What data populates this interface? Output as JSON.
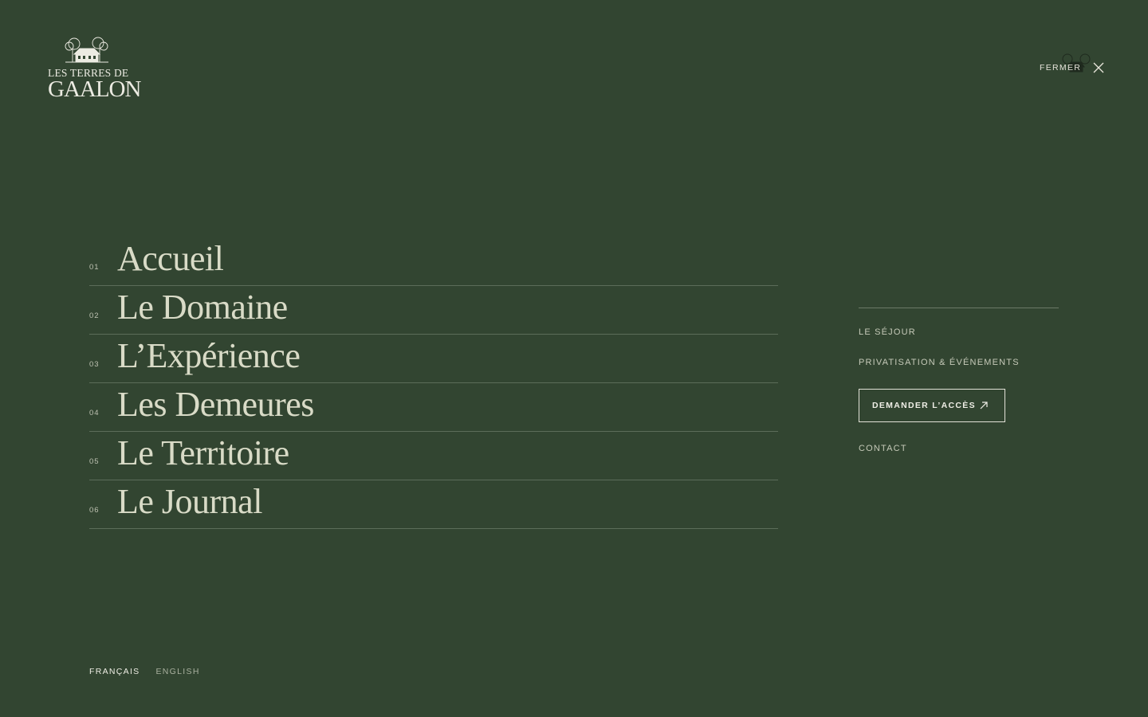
{
  "brand": {
    "line1": "LES TERRES DE",
    "line2": "GAALON"
  },
  "header": {
    "close_label": "FERMER",
    "close_icon": "close-icon"
  },
  "nav": {
    "items": [
      {
        "num": "01",
        "label": "Accueil"
      },
      {
        "num": "02",
        "label": "Le Domaine"
      },
      {
        "num": "03",
        "label": "L’Expérience"
      },
      {
        "num": "04",
        "label": "Les Demeures"
      },
      {
        "num": "05",
        "label": "Le Territoire"
      },
      {
        "num": "06",
        "label": "Le Journal"
      }
    ]
  },
  "side": {
    "sejour": "LE SÉJOUR",
    "privatisation": "PRIVATISATION & ÉVÉNEMENTS",
    "cta_label": "DEMANDER L’ACCÈS",
    "cta_icon": "arrow-up-right-icon",
    "contact": "CONTACT"
  },
  "languages": {
    "active": "FRANÇAIS",
    "other": "ENGLISH"
  },
  "colors": {
    "background": "#324531",
    "text": "#e9e7dc",
    "nav_text": "#d9dbc7",
    "divider": "#5c6d5a"
  }
}
